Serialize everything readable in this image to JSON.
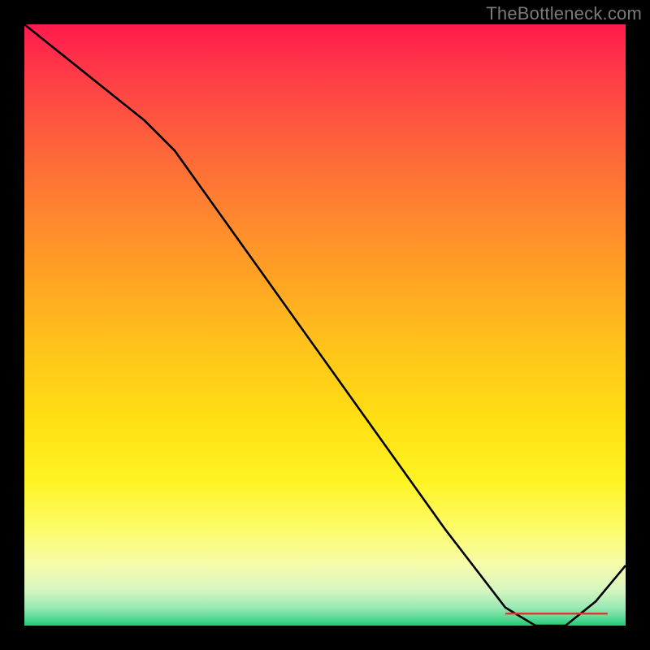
{
  "watermark": "TheBottleneck.com",
  "chart_data": {
    "type": "line",
    "title": "",
    "xlabel": "",
    "ylabel": "",
    "xlim": [
      0,
      100
    ],
    "ylim": [
      0,
      100
    ],
    "background_gradient": {
      "top_color": "#ff1a4d",
      "mid_color": "#ffe013",
      "bottom_color": "#1fc972",
      "meaning": "red (top) = high bottleneck, green (bottom) = low bottleneck"
    },
    "series": [
      {
        "name": "bottleneck-curve",
        "x": [
          0,
          10,
          20,
          25,
          30,
          40,
          50,
          60,
          70,
          80,
          85,
          90,
          95,
          100
        ],
        "values": [
          100,
          92,
          84,
          79,
          72,
          58,
          44,
          30,
          16,
          3,
          0,
          0,
          4,
          10
        ]
      }
    ],
    "annotations": [
      {
        "name": "optimal-label-strike",
        "type": "horizontal-strikethrough",
        "x_start": 80,
        "x_end": 97,
        "y": 2
      }
    ]
  },
  "colors": {
    "frame": "#000000",
    "watermark_text": "#7a7a7a",
    "label_red": "#d33a2f",
    "line": "#000000"
  }
}
